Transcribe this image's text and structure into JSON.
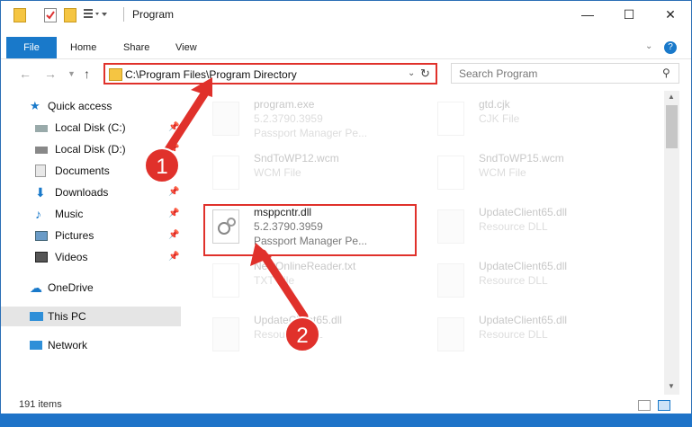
{
  "window": {
    "title": "Program"
  },
  "ribbon": {
    "file": "File",
    "home": "Home",
    "share": "Share",
    "view": "View"
  },
  "address": {
    "path": "C:\\Program Files\\Program Directory"
  },
  "search": {
    "placeholder": "Search Program"
  },
  "sidebar": {
    "items": [
      {
        "label": "Quick access"
      },
      {
        "label": "Local Disk (C:)"
      },
      {
        "label": "Local Disk (D:)"
      },
      {
        "label": "Documents"
      },
      {
        "label": "Downloads"
      },
      {
        "label": "Music"
      },
      {
        "label": "Pictures"
      },
      {
        "label": "Videos"
      },
      {
        "label": "OneDrive"
      },
      {
        "label": "This PC"
      },
      {
        "label": "Network"
      }
    ]
  },
  "files": {
    "f1": {
      "name": "program.exe",
      "l2": "5.2.3790.3959",
      "l3": "Passport Manager Pe..."
    },
    "f2": {
      "name": "gtd.cjk",
      "l2": "CJK File"
    },
    "f3": {
      "name": "SndToWP12.wcm",
      "l2": "WCM File"
    },
    "f4": {
      "name": "SndToWP15.wcm",
      "l2": "WCM File"
    },
    "f5": {
      "name": "msppcntr.dll",
      "l2": "5.2.3790.3959",
      "l3": "Passport Manager Pe..."
    },
    "f6": {
      "name": "UpdateClient65.dll",
      "l2": "Resource DLL"
    },
    "f7": {
      "name": "NewOnlineReader.txt",
      "l2": "TXT File"
    },
    "f8": {
      "name": "UpdateClient65.dll",
      "l2": "Resource DLL"
    },
    "f9": {
      "name": "UpdateClient65.dll",
      "l2": "Resource DLL"
    },
    "f10": {
      "name": "UpdateClient65.dll",
      "l2": "Resource DLL"
    }
  },
  "status": {
    "count": "191 items"
  },
  "callouts": {
    "one": "1",
    "two": "2"
  },
  "colors": {
    "accent": "#1979ca",
    "highlight": "#e0312b"
  }
}
